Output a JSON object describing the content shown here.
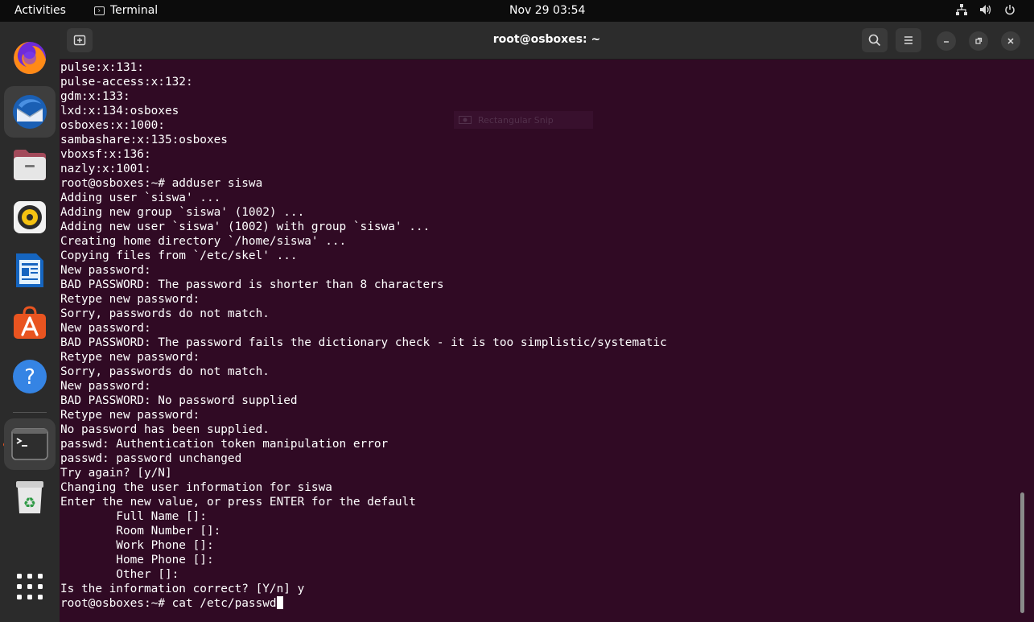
{
  "topbar": {
    "activities": "Activities",
    "app_name": "Terminal",
    "clock": "Nov 29  03:54"
  },
  "dock": {
    "items": [
      "firefox-icon",
      "thunderbird-icon",
      "files-icon",
      "rhythmbox-icon",
      "writer-icon",
      "software-icon",
      "help-icon",
      "terminal-icon",
      "trash-icon",
      "app-grid-icon"
    ]
  },
  "window": {
    "title": "root@osboxes: ~",
    "snip_label": "Rectangular Snip"
  },
  "terminal": {
    "lines": [
      "pulse:x:131:",
      "pulse-access:x:132:",
      "gdm:x:133:",
      "lxd:x:134:osboxes",
      "osboxes:x:1000:",
      "sambashare:x:135:osboxes",
      "vboxsf:x:136:",
      "nazly:x:1001:",
      "root@osboxes:~# adduser siswa",
      "Adding user `siswa' ...",
      "Adding new group `siswa' (1002) ...",
      "Adding new user `siswa' (1002) with group `siswa' ...",
      "Creating home directory `/home/siswa' ...",
      "Copying files from `/etc/skel' ...",
      "New password:",
      "BAD PASSWORD: The password is shorter than 8 characters",
      "Retype new password:",
      "Sorry, passwords do not match.",
      "New password:",
      "BAD PASSWORD: The password fails the dictionary check - it is too simplistic/systematic",
      "Retype new password:",
      "Sorry, passwords do not match.",
      "New password:",
      "BAD PASSWORD: No password supplied",
      "Retype new password:",
      "No password has been supplied.",
      "passwd: Authentication token manipulation error",
      "passwd: password unchanged",
      "Try again? [y/N]",
      "Changing the user information for siswa",
      "Enter the new value, or press ENTER for the default",
      "        Full Name []:",
      "        Room Number []:",
      "        Work Phone []:",
      "        Home Phone []:",
      "        Other []:",
      "Is the information correct? [Y/n] y"
    ],
    "prompt_line": "root@osboxes:~# cat /etc/passwd"
  },
  "colors": {
    "terminal_bg": "#300a24",
    "header_bg": "#2c2c2c",
    "dock_bg": "#2b2b2b",
    "accent": "#e95420"
  }
}
